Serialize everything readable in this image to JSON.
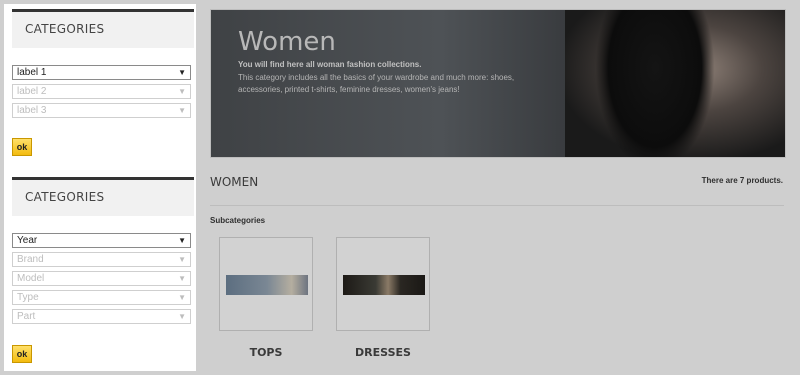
{
  "sidebar": {
    "block1": {
      "heading": "CATEGORIES",
      "selects": [
        {
          "value": "label 1",
          "active": true
        },
        {
          "value": "label 2",
          "active": false
        },
        {
          "value": "label 3",
          "active": false
        }
      ],
      "ok_label": "ok"
    },
    "block2": {
      "heading": "CATEGORIES",
      "selects": [
        {
          "value": "Year",
          "active": true
        },
        {
          "value": "Brand",
          "active": false
        },
        {
          "value": "Model",
          "active": false
        },
        {
          "value": "Type",
          "active": false
        },
        {
          "value": "Part",
          "active": false
        }
      ],
      "ok_label": "ok"
    }
  },
  "banner": {
    "title": "Women",
    "subtitle": "You will find here all woman fashion collections.",
    "description": "This category includes all the basics of your wardrobe and much more: shoes, accessories, printed t-shirts, feminine dresses, women's jeans!"
  },
  "main": {
    "category_title": "WOMEN",
    "product_count": "There are 7 products.",
    "subcategories_label": "Subcategories",
    "subcategories": [
      {
        "label": "TOPS"
      },
      {
        "label": "DRESSES"
      }
    ]
  },
  "icons": {
    "select_arrow": "chevron-down-icon"
  }
}
